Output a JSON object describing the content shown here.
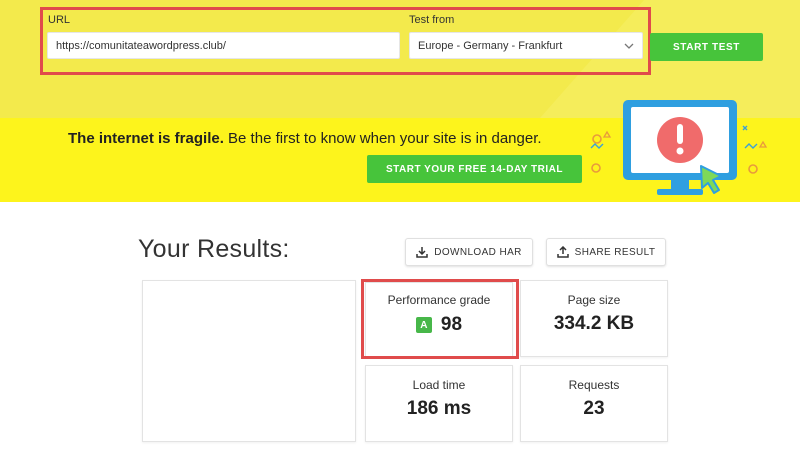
{
  "test_form": {
    "url_label": "URL",
    "url_value": "https://comunitateawordpress.club/",
    "location_label": "Test from",
    "location_value": "Europe - Germany - Frankfurt",
    "start_button": "START TEST"
  },
  "promo": {
    "headline_bold": "The internet is fragile.",
    "headline_rest": " Be the first to know when your site is in danger.",
    "trial_button": "START YOUR FREE 14-DAY TRIAL"
  },
  "results": {
    "title": "Your Results:",
    "download_button": "DOWNLOAD HAR",
    "share_button": "SHARE RESULT",
    "performance_label": "Performance grade",
    "performance_grade": "A",
    "performance_value": "98",
    "page_size_label": "Page size",
    "page_size_value": "334.2 KB",
    "load_time_label": "Load time",
    "load_time_value": "186 ms",
    "requests_label": "Requests",
    "requests_value": "23"
  },
  "colors": {
    "accent_green": "#47c43b",
    "banner_yellow": "#fdf41c",
    "highlight_red": "#e04b4b"
  }
}
